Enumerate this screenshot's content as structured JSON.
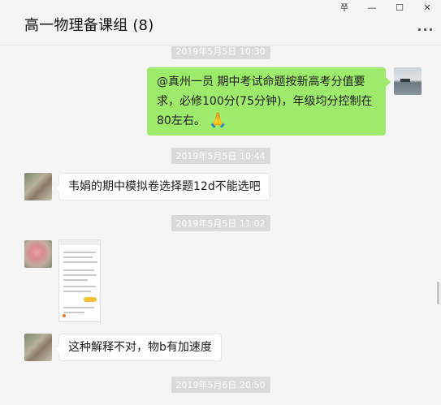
{
  "window": {
    "title": "高一物理备课组 (8)",
    "controls": {
      "pin": "쭈",
      "minimize": "—",
      "maximize": "☐",
      "close": "✕"
    }
  },
  "messages": {
    "ts_first": "2019年5月5日 10:30",
    "outgoing_text": "@真州一员  期中考试命题按新高考分值要求，必修100分(75分钟)，年级均分控制在80左右。",
    "outgoing_emoji": "🙏",
    "ts_second": "2019年5月5日 10:44",
    "incoming_1": "韦娟的期中模拟卷选择题12d不能选吧",
    "ts_third": "2019年5月5日 11:02",
    "incoming_3": "这种解释不对，物b有加速度",
    "ts_fourth": "2019年5月6日 20:50"
  },
  "colors": {
    "outgoing_bubble": "#9eea6a",
    "incoming_bubble": "#ffffff",
    "background": "#f5f5f5",
    "timestamp_bg": "#dadada"
  }
}
